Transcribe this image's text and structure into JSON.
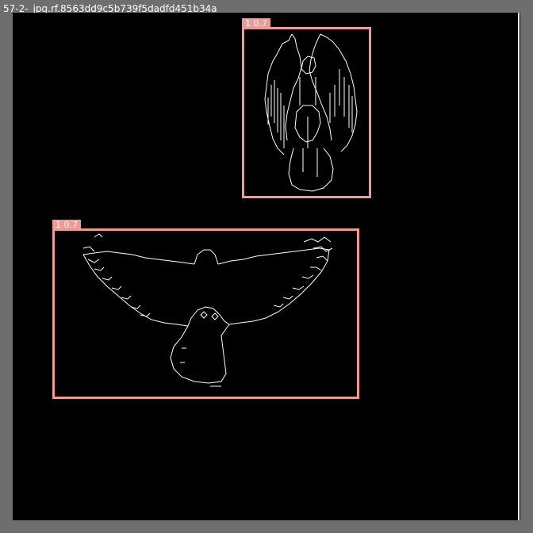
{
  "image": {
    "filename": "57-2-_jpg.rf.8563dd9c5b739f5dadfd451b34a"
  },
  "detections": [
    {
      "label": "1 0.7",
      "object": "angel-figure",
      "color": "#f19a95"
    },
    {
      "label": "1 0.7",
      "object": "bird-spread-wings",
      "color": "#f19a95"
    }
  ],
  "colors": {
    "background": "#6e6e6e",
    "canvas": "#000000",
    "box": "#f19a95",
    "edge": "#ffffff"
  }
}
